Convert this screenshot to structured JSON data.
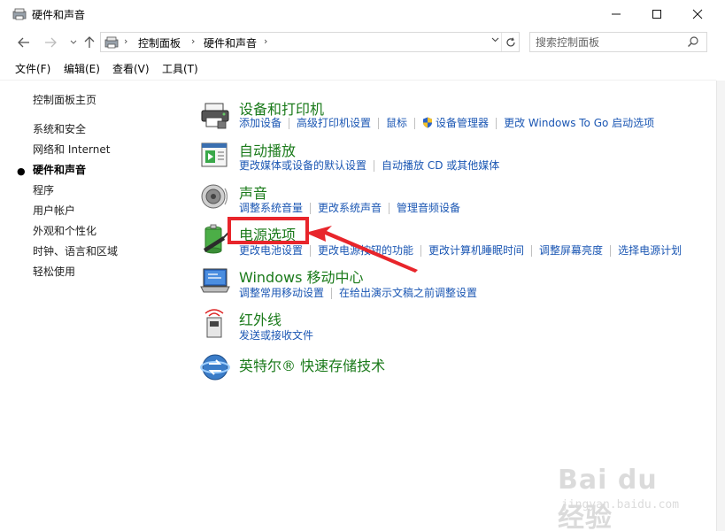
{
  "window": {
    "title": "硬件和声音",
    "minimize_icon": "minimize-icon",
    "maximize_icon": "maximize-icon",
    "close_icon": "close-icon"
  },
  "address_bar": {
    "crumbs": [
      "控制面板",
      "硬件和声音"
    ]
  },
  "search": {
    "placeholder": "搜索控制面板"
  },
  "menu": [
    "文件(F)",
    "编辑(E)",
    "查看(V)",
    "工具(T)"
  ],
  "left_nav": {
    "home": "控制面板主页",
    "items": [
      {
        "label": "系统和安全",
        "current": false
      },
      {
        "label": "网络和 Internet",
        "current": false
      },
      {
        "label": "硬件和声音",
        "current": true
      },
      {
        "label": "程序",
        "current": false
      },
      {
        "label": "用户帐户",
        "current": false
      },
      {
        "label": "外观和个性化",
        "current": false
      },
      {
        "label": "时钟、语言和区域",
        "current": false
      },
      {
        "label": "轻松使用",
        "current": false
      }
    ]
  },
  "categories": [
    {
      "title": "设备和打印机",
      "icon": "printer-icon",
      "links": [
        "添加设备",
        "高级打印机设置",
        "鼠标",
        "设备管理器",
        "更改 Windows To Go 启动选项"
      ]
    },
    {
      "title": "自动播放",
      "icon": "autoplay-icon",
      "links": [
        "更改媒体或设备的默认设置",
        "自动播放 CD 或其他媒体"
      ]
    },
    {
      "title": "声音",
      "icon": "speaker-icon",
      "links": [
        "调整系统音量",
        "更改系统声音",
        "管理音频设备"
      ]
    },
    {
      "title": "电源选项",
      "icon": "battery-icon",
      "links": [
        "更改电池设置",
        "更改电源按钮的功能",
        "更改计算机睡眠时间",
        "调整屏幕亮度",
        "选择电源计划"
      ]
    },
    {
      "title": "Windows 移动中心",
      "icon": "mobility-center-icon",
      "links": [
        "调整常用移动设置",
        "在给出演示文稿之前调整设置"
      ]
    },
    {
      "title": "红外线",
      "icon": "infrared-icon",
      "links": [
        "发送或接收文件"
      ]
    },
    {
      "title": "英特尔® 快速存储技术",
      "icon": "intel-rst-icon",
      "links": []
    }
  ],
  "watermark": {
    "main": "Bai du 经验",
    "sub": "jingyan.baidu.com"
  },
  "colors": {
    "category_title": "#1a7a1a",
    "link": "#1a56b3",
    "highlight": "#e8252b"
  }
}
